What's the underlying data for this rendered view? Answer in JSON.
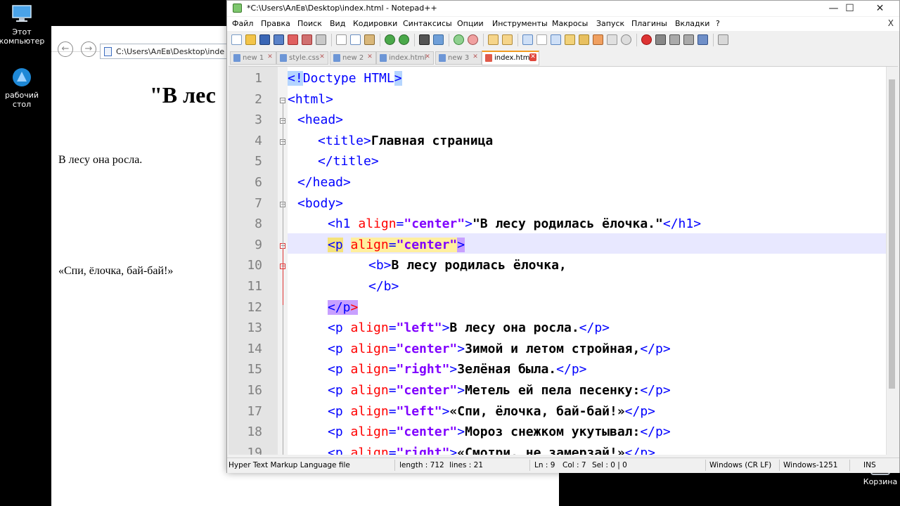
{
  "desktop": {
    "icons": [
      {
        "label_line1": "Этот",
        "label_line2": "компьютер"
      },
      {
        "label_line1": "рабочий",
        "label_line2": "стол"
      }
    ],
    "recycle_label": "Корзина"
  },
  "browser": {
    "back_glyph": "←",
    "forward_glyph": "→",
    "address": "C:\\Users\\АлЕв\\Desktop\\inde",
    "heading": "\"В лес",
    "paragraph1": "В лесу она росла.",
    "paragraph2": "«Спи, ёлочка, бай-бай!»"
  },
  "npp": {
    "title": "*C:\\Users\\АлЕв\\Desktop\\index.html - Notepad++",
    "window_buttons": {
      "minimize": "—",
      "maximize": "☐",
      "close": "✕"
    },
    "menu": [
      "Файл",
      "Правка",
      "Поиск",
      "Вид",
      "Кодировки",
      "Синтаксисы",
      "Опции",
      "Инструменты",
      "Макросы",
      "Запуск",
      "Плагины",
      "Вкладки",
      "?"
    ],
    "menu_close": "X",
    "tabs": [
      {
        "label": "new 1",
        "icon": "doc-blue-icon"
      },
      {
        "label": "style.css",
        "icon": "doc-blue-icon"
      },
      {
        "label": "new 2",
        "icon": "doc-blue-icon"
      },
      {
        "label": "index.html",
        "icon": "doc-blue-icon"
      },
      {
        "label": "new 3",
        "icon": "doc-blue-icon"
      },
      {
        "label": "index.html",
        "icon": "doc-red-icon",
        "active": true
      }
    ],
    "tab_close_glyph": "✕",
    "line_numbers": [
      "1",
      "2",
      "3",
      "4",
      "5",
      "6",
      "7",
      "8",
      "9",
      "10",
      "11",
      "12",
      "13",
      "14",
      "15",
      "16",
      "17",
      "18",
      "19"
    ],
    "code": {
      "l1": {
        "open": "<!",
        "rest": "Doctype HTML",
        "close": ">"
      },
      "l2": "<html>",
      "l3": "<head>",
      "l4": {
        "tag_open": "<title>",
        "text": "Главная страница"
      },
      "l5": "</title>",
      "l6": "</head>",
      "l7": "<body>",
      "l8": {
        "t1": "<h1 ",
        "attr": "align",
        "eq": "=",
        "val": "\"center\"",
        "t2": ">",
        "text": "\"В лесу родилась ёлочка.\"",
        "t3": "</h1>"
      },
      "l9": {
        "lt": "<",
        "p": "p",
        "sp": " ",
        "attr": "align",
        "eq": "=",
        "val": "\"center\"",
        "gt": ">"
      },
      "l10": {
        "t1": "<b>",
        "text": "В лесу родилась ёлочка,"
      },
      "l11": "</b>",
      "l12": {
        "t1": "</p",
        "gt": ">"
      },
      "l13": {
        "t1": "<p ",
        "attr": "align",
        "eq": "=",
        "val": "\"left\"",
        "t2": ">",
        "text": "В лесу она росла.",
        "t3": "</p>"
      },
      "l14": {
        "t1": "<p ",
        "attr": "align",
        "eq": "=",
        "val": "\"center\"",
        "t2": ">",
        "text": "Зимой и летом стройная,",
        "t3": "</p>"
      },
      "l15": {
        "t1": "<p ",
        "attr": "align",
        "eq": "=",
        "val": "\"right\"",
        "t2": ">",
        "text": "Зелёная была.",
        "t3": "</p>"
      },
      "l16": {
        "t1": "<p ",
        "attr": "align",
        "eq": "=",
        "val": "\"center\"",
        "t2": ">",
        "text": "Метель ей пела песенку:",
        "t3": "</p>"
      },
      "l17": {
        "t1": "<p ",
        "attr": "align",
        "eq": "=",
        "val": "\"left\"",
        "t2": ">",
        "text": "«Спи, ёлочка, бай-бай!»",
        "t3": "</p>"
      },
      "l18": {
        "t1": "<p ",
        "attr": "align",
        "eq": "=",
        "val": "\"center\"",
        "t2": ">",
        "text": "Мороз снежком укутывал:",
        "t3": "</p>"
      },
      "l19": {
        "t1": "<p ",
        "attr": "align",
        "eq": "=",
        "val": "\"right\"",
        "t2": ">",
        "text": "«Смотри, не замерзай!»",
        "t3": "</p>"
      }
    },
    "status": {
      "file_type": "Hyper Text Markup Language file",
      "length": "length : 712",
      "lines": "lines : 21",
      "ln": "Ln : 9",
      "col": "Col : 7",
      "sel": "Sel : 0 | 0",
      "eol": "Windows (CR LF)",
      "encoding": "Windows-1251",
      "ins": "INS"
    }
  }
}
